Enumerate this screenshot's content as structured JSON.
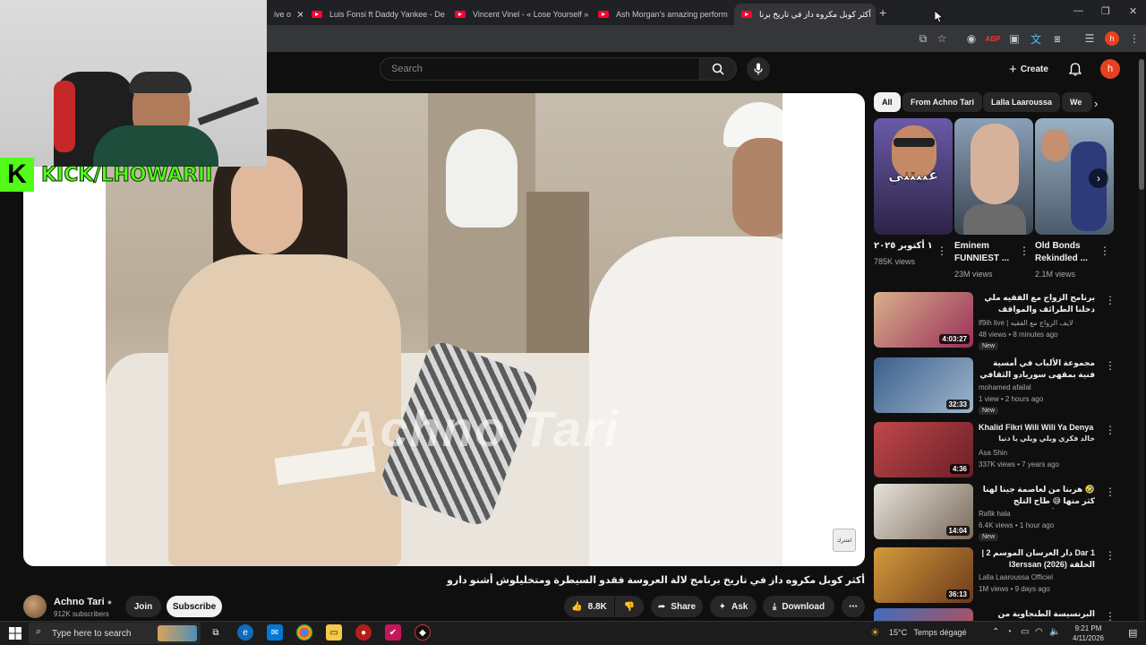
{
  "browser": {
    "tabs": [
      {
        "title": "ive o"
      },
      {
        "title": "Luis Fonsi ft Daddy Yankee - De"
      },
      {
        "title": "Vincent Vinel - « Lose Yourself »"
      },
      {
        "title": "Ash Morgan's amazing perform"
      },
      {
        "title": "أكثر كوبل مكروه داز في تاريخ برنا"
      }
    ],
    "profile_initial": "h"
  },
  "youtube": {
    "search_placeholder": "Search",
    "create_label": "Create",
    "avatar_initial": "h"
  },
  "overlay": {
    "kick_logo": "K",
    "kick_text": "KICK/LHOWARII"
  },
  "video": {
    "watermark": "Achno Tari",
    "corner_badge": "اشترك",
    "title": "أكثر كوبل مكروه داز في تاريخ برنامج لالة العروسة فقدو السيطرة ومتخليلوش أشنو دارو",
    "channel": "Achno Tari",
    "subscribers": "912K subscribers",
    "join_label": "Join",
    "subscribe_label": "Subscribe",
    "likes": "8.8K",
    "share_label": "Share",
    "ask_label": "Ask",
    "download_label": "Download"
  },
  "sidebar": {
    "chips": [
      "All",
      "From Achno Tari",
      "Lalla Laaroussa",
      "We"
    ],
    "shorts": [
      {
        "overlay_text": "غبيتني",
        "title": "١ أكتوبر ٢٠٢٥",
        "views": "785K views"
      },
      {
        "title": "Eminem FUNNIEST ...",
        "views": "23M views"
      },
      {
        "title": "Old Bonds Rekindled ...",
        "views": "2.1M views"
      }
    ],
    "recommendations": [
      {
        "title": "برنامج الزواج مع الفقيه ملي دخلنا الطرائف والمواقف المتكاهية",
        "channel": "lf9ih live | لايف الزواج مع الفقيه",
        "meta": "48 views • 8 minutes ago",
        "badge": "New",
        "duration": "4:03:27"
      },
      {
        "title": "مجموعة الألباب في أمسية فنية بمقهى سوريادو الثقافي تطوان",
        "channel": "mohamed afailal",
        "meta": "1 view • 2 hours ago",
        "badge": "New",
        "duration": "32:33"
      },
      {
        "title": "Khalid Fikri Wili Wili Ya Denya",
        "subtitle": "خالد فكري ويلي ويلي يا دنيا",
        "channel": "Asa Shin",
        "meta": "337K views • 7 years ago",
        "duration": "4:36"
      },
      {
        "title": "🤣 هربنا من لعاصمة جينا لهنا كثر منها 😅 طاح التلج فمراكش ❄️",
        "channel": "Rafik hala",
        "meta": "6.4K views • 1 hour ago",
        "badge": "New",
        "duration": "14:04"
      },
      {
        "title": "Dar 1 دار العرسان الموسم 2 | الحلقة l3erssan (2026)",
        "channel": "Lalla Laaroussa Officiel",
        "meta": "1M views • 9 days ago",
        "duration": "36:13"
      },
      {
        "title": "البرنسيسة الطنجاوية من التحدية فاتت الحدود",
        "channel": "",
        "meta": "",
        "duration": ""
      }
    ]
  },
  "taskbar": {
    "search_placeholder": "Type here to search",
    "weather_temp": "15°C",
    "weather_desc": "Temps dégagé",
    "time": "9:21 PM",
    "date": "4/11/2026"
  }
}
